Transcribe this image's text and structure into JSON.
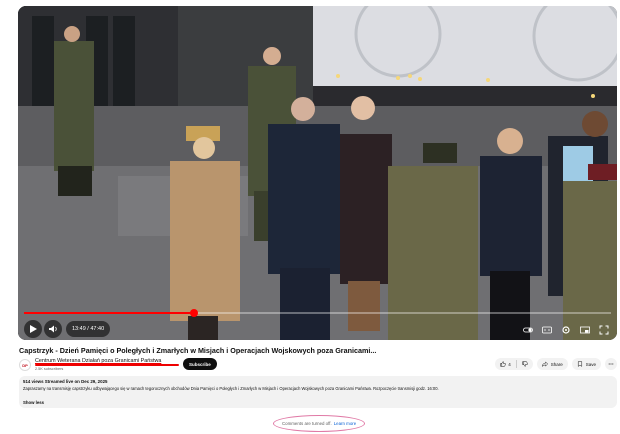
{
  "player": {
    "time_current": "13:49",
    "time_total": "47:40",
    "time_separator": " / ",
    "progress": 0.29
  },
  "video": {
    "title": "Capstrzyk - Dzień Pamięci o Poległych i Zmarłych w Misjach i Operacjach Wojskowych poza Granicami..."
  },
  "channel": {
    "avatar_text": "DP",
    "name": "Centrum Weterana Działań poza Granicami Państwa",
    "subscribers": "2.5K subscribers",
    "subscribe_label": "Subscribe"
  },
  "actions": {
    "likes": "4",
    "share_label": "Share",
    "save_label": "Save"
  },
  "description": {
    "meta": "514 views  Streamed live on Dec 29, 2025",
    "text": "Zapraszamy na transmisję capstrzyku odbywającego się w ramach tegorocznych obchodów Dnia Pamięci o Poległych i Zmarłych w Misjach i Operacjach Wojskowych poza Granicami Państwa. Rozpoczęcie transmisji godz. 16:00.",
    "show_less": "Show less"
  },
  "comments": {
    "off_text": "Comments are turned off.",
    "learn_more": "Learn more"
  },
  "icons": {
    "play": "play-icon",
    "volume": "volume-icon",
    "settings": "settings-icon",
    "fullscreen": "fullscreen-icon"
  }
}
